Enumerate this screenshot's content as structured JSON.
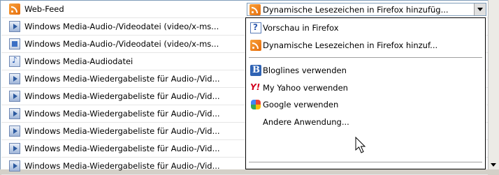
{
  "rows": [
    {
      "type": "Web-Feed",
      "icon": "rss-feed-icon"
    },
    {
      "type": "Windows Media-Audio-/Videodatei (video/x-ms...",
      "icon": "media-player-file-icon"
    },
    {
      "type": "Windows Media-Audio-/Videodatei (video/x-ms...",
      "icon": "media-video-file-icon"
    },
    {
      "type": "Windows Media-Audiodatei",
      "icon": "audio-note-icon"
    },
    {
      "type": "Windows Media-Wiedergabeliste für Audio-/Vid...",
      "icon": "media-player-file-icon"
    },
    {
      "type": "Windows Media-Wiedergabeliste für Audio-/Vid...",
      "icon": "media-player-file-icon"
    },
    {
      "type": "Windows Media-Wiedergabeliste für Audio-/Vid...",
      "icon": "media-player-file-icon"
    },
    {
      "type": "Windows Media-Wiedergabeliste für Audio-/Vid...",
      "icon": "media-player-file-icon"
    }
  ],
  "action_combo": {
    "value": "Dynamische Lesezeichen in Firefox hinzufüg..."
  },
  "menu": {
    "preview": "Vorschau in Firefox",
    "live_bookmarks": "Dynamische Lesezeichen in Firefox hinzuf...",
    "bloglines": "Bloglines verwenden",
    "yahoo": "My Yahoo verwenden",
    "google": "Google verwenden",
    "other": "Andere Anwendung..."
  },
  "colors": {
    "rss": "#e56d0d",
    "border": "#7f9db9",
    "yahoo": "#d2001e",
    "bloglines": "#2f63b4"
  }
}
